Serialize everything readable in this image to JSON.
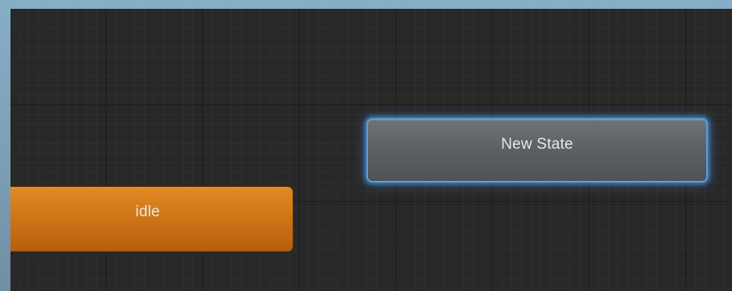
{
  "animator_graph": {
    "states": {
      "idle": {
        "label": "idle",
        "color": "#cd7517"
      },
      "new_state": {
        "label": "New State",
        "color": "#5c5f63",
        "selected": true,
        "selection_color": "#5d9ed6"
      }
    },
    "grid_color": "#282828"
  }
}
